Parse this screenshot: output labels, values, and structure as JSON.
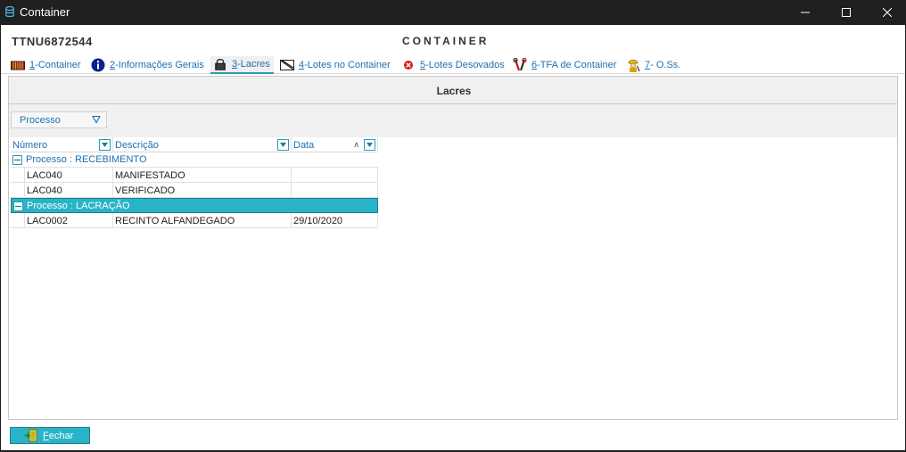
{
  "window": {
    "title": "Container"
  },
  "header": {
    "record_id": "TTNU6872544",
    "form_title": "CONTAINER"
  },
  "tabs": [
    {
      "key": "1",
      "label": "-Container",
      "icon": "container-icon"
    },
    {
      "key": "2",
      "label": "-Informações Gerais",
      "icon": "info-icon"
    },
    {
      "key": "3",
      "label": "-Lacres",
      "icon": "padlock-icon",
      "active": true
    },
    {
      "key": "4",
      "label": "-Lotes no Container",
      "icon": "crate-icon"
    },
    {
      "key": "5",
      "label": "-Lotes Desovados",
      "icon": "stop-icon"
    },
    {
      "key": "6",
      "label": "-TFA de Container",
      "icon": "tools-icon"
    },
    {
      "key": "7",
      "label": "- O.Ss.",
      "icon": "worker-icon"
    }
  ],
  "section": {
    "title": "Lacres"
  },
  "grouping": {
    "chip_label": "Processo"
  },
  "grid": {
    "columns": {
      "numero": "Número",
      "descricao": "Descrição",
      "data": "Data",
      "sort_indicator": "∧"
    },
    "groups": [
      {
        "label": "Processo : RECEBIMENTO",
        "selected": false,
        "rows": [
          {
            "numero": "LAC040",
            "descricao": "MANIFESTADO",
            "data": ""
          },
          {
            "numero": "LAC040",
            "descricao": "VERIFICADO",
            "data": ""
          }
        ]
      },
      {
        "label": "Processo : LACRAÇÃO",
        "selected": true,
        "rows": [
          {
            "numero": "LAC0002",
            "descricao": "RECINTO ALFANDEGADO",
            "data": "29/10/2020"
          }
        ]
      }
    ]
  },
  "footer": {
    "close_key": "F",
    "close_rest": "echar"
  },
  "colors": {
    "accent": "#2ab3c6",
    "link": "#1e6fb0",
    "titlebar": "#202020"
  }
}
